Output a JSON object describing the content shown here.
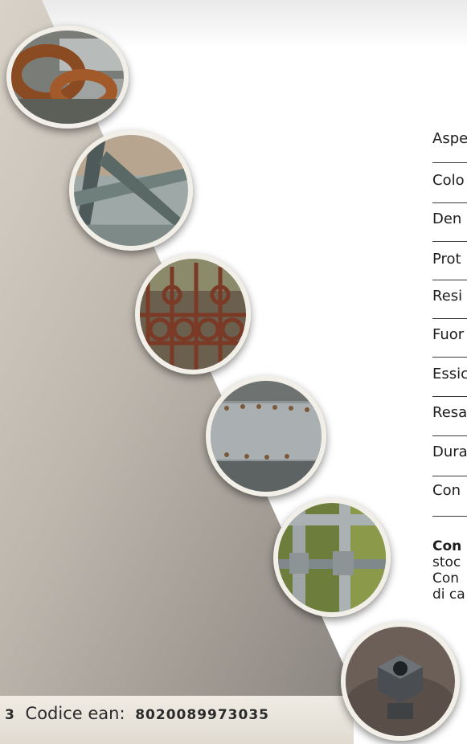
{
  "specs": [
    "Aspe",
    "Colo",
    "Den",
    "Prot",
    "Resi",
    "Fuor",
    "Essic",
    "Resa",
    "Dura",
    "Con"
  ],
  "note": {
    "line1": "Con",
    "line2": "stoc",
    "line3": "Con",
    "line4": "di ca"
  },
  "footer": {
    "code_fragment": "3",
    "ean_label": "Codice ean:",
    "ean_value": "8020089973035"
  },
  "icons": [
    "rusty-chain-photo-icon",
    "metal-frame-photo-icon",
    "rusty-gate-photo-icon",
    "riveted-metal-photo-icon",
    "galvanized-fence-photo-icon",
    "hex-bolt-photo-icon"
  ]
}
